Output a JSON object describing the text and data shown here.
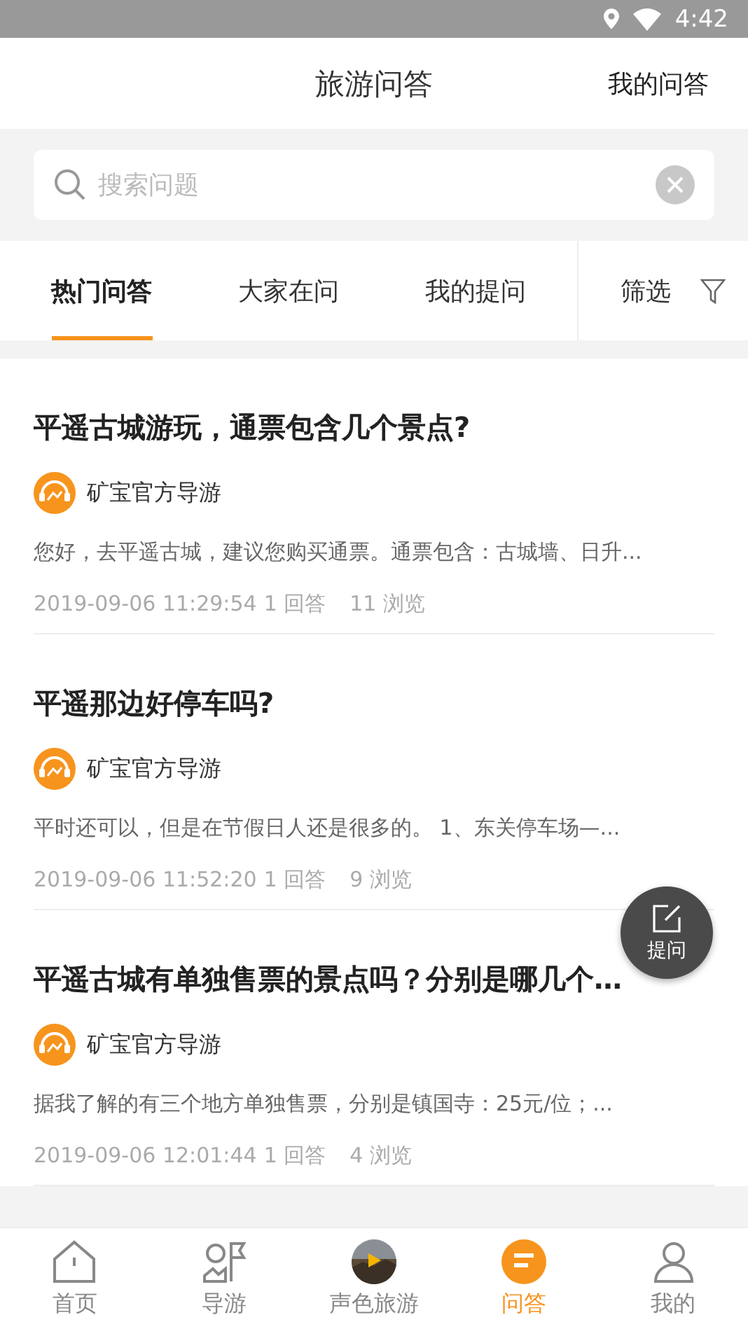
{
  "status_bar": {
    "time": "4:42"
  },
  "header": {
    "title": "旅游问答",
    "action": "我的问答"
  },
  "search": {
    "placeholder": "搜索问题"
  },
  "tabs": [
    {
      "label": "热门问答",
      "selected": true
    },
    {
      "label": "大家在问",
      "selected": false
    },
    {
      "label": "我的提问",
      "selected": false
    }
  ],
  "filter": {
    "label": "筛选"
  },
  "questions": [
    {
      "title": "平遥古城游玩，通票包含几个景点?",
      "author": "矿宝官方导游",
      "answer": "您好，去平遥古城，建议您购买通票。通票包含：古城墙、日升...",
      "time": "2019-09-06 11:29:54",
      "answers": "1 回答",
      "views": "11 浏览"
    },
    {
      "title": "平遥那边好停车吗?",
      "author": "矿宝官方导游",
      "answer": "平时还可以，但是在节假日人还是很多的。 1、东关停车场—...",
      "time": "2019-09-06 11:52:20",
      "answers": "1 回答",
      "views": "9 浏览"
    },
    {
      "title": "平遥古城有单独售票的景点吗？分别是哪几个…",
      "author": "矿宝官方导游",
      "answer": "据我了解的有三个地方单独售票，分别是镇国寺：25元/位；...",
      "time": "2019-09-06 12:01:44",
      "answers": "1 回答",
      "views": "4 浏览"
    }
  ],
  "fab": {
    "label": "提问"
  },
  "bottom_nav": [
    {
      "label": "首页",
      "kind": "home",
      "selected": false
    },
    {
      "label": "导游",
      "kind": "guide",
      "selected": false
    },
    {
      "label": "声色旅游",
      "selected": false
    },
    {
      "label": "问答",
      "kind": "qa",
      "selected": true
    },
    {
      "label": "我的",
      "kind": "me",
      "selected": false
    }
  ]
}
